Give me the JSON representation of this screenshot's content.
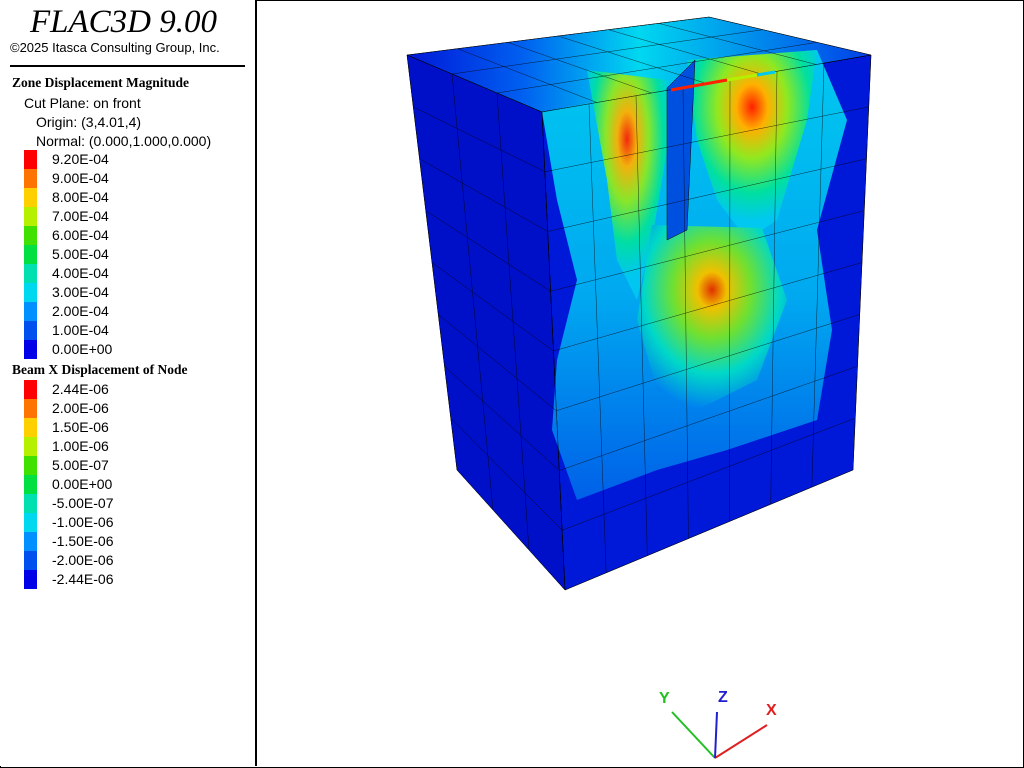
{
  "app": {
    "title": "FLAC3D 9.00",
    "copyright": "©2025 Itasca Consulting Group, Inc."
  },
  "zone_legend": {
    "title": "Zone Displacement Magnitude",
    "cut_plane": "Cut Plane: on front",
    "origin": "Origin: (3,4.01,4)",
    "normal": "Normal: (0.000,1.000,0.000)",
    "entries": [
      {
        "label": "9.20E-04",
        "color": "#ff0000"
      },
      {
        "label": "9.00E-04",
        "color": "#ff7400"
      },
      {
        "label": "8.00E-04",
        "color": "#ffd000"
      },
      {
        "label": "7.00E-04",
        "color": "#b4f000"
      },
      {
        "label": "6.00E-04",
        "color": "#40e000"
      },
      {
        "label": "5.00E-04",
        "color": "#00e040"
      },
      {
        "label": "4.00E-04",
        "color": "#00e0b0"
      },
      {
        "label": "3.00E-04",
        "color": "#00d8f0"
      },
      {
        "label": "2.00E-04",
        "color": "#0090ff"
      },
      {
        "label": "1.00E-04",
        "color": "#0050f0"
      },
      {
        "label": "0.00E+00",
        "color": "#0000e8"
      }
    ]
  },
  "beam_legend": {
    "title": "Beam X Displacement of Node",
    "entries": [
      {
        "label": "2.44E-06",
        "color": "#ff0000"
      },
      {
        "label": "2.00E-06",
        "color": "#ff7400"
      },
      {
        "label": "1.50E-06",
        "color": "#ffd000"
      },
      {
        "label": "1.00E-06",
        "color": "#b4f000"
      },
      {
        "label": "5.00E-07",
        "color": "#40e000"
      },
      {
        "label": "0.00E+00",
        "color": "#00e040"
      },
      {
        "label": "-5.00E-07",
        "color": "#00e0b0"
      },
      {
        "label": "-1.00E-06",
        "color": "#00d8f0"
      },
      {
        "label": "-1.50E-06",
        "color": "#0090ff"
      },
      {
        "label": "-2.00E-06",
        "color": "#0050f0"
      },
      {
        "label": "-2.44E-06",
        "color": "#0000e8"
      }
    ]
  },
  "axes": {
    "x_label": "X",
    "y_label": "Y",
    "z_label": "Z",
    "x_color": "#e02020",
    "y_color": "#20c020",
    "z_color": "#2020d0"
  }
}
